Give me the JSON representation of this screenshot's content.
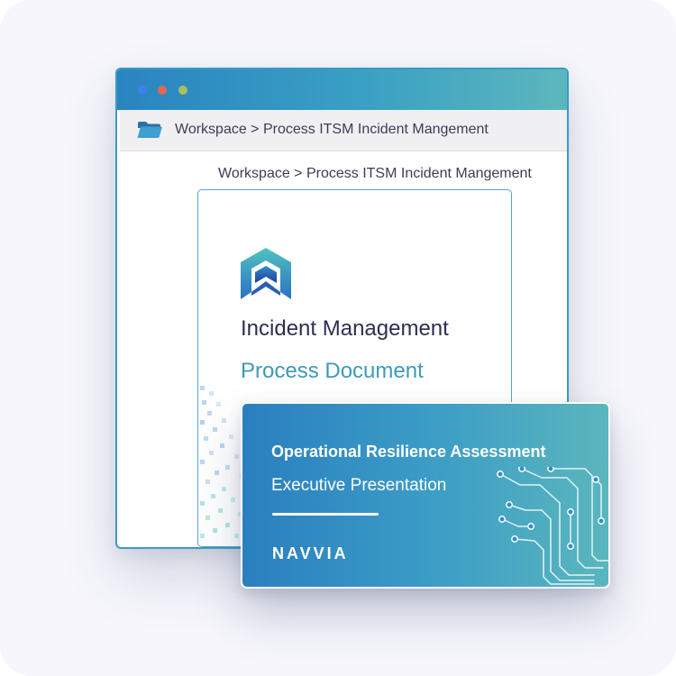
{
  "window": {
    "address_path": "Workspace > Process ITSM Incident Mangement",
    "breadcrumb": "Workspace > Process ITSM Incident Mangement",
    "controls": [
      "close",
      "minimize",
      "maximize"
    ]
  },
  "document": {
    "title": "Incident Management",
    "subtitle": "Process Document"
  },
  "card": {
    "title": "Operational Resilience Assessment",
    "subtitle": "Executive Presentation",
    "brand": "NAVVIA"
  },
  "icons": {
    "folder": "folder-icon",
    "logo": "navvia-logo-mark",
    "circuit": "circuit-board-graphic"
  },
  "colors": {
    "accent_blue": "#2a84c0",
    "accent_teal": "#5cb7bd",
    "title_text": "#2e2e52",
    "subtitle_text": "#3d9ab8"
  }
}
